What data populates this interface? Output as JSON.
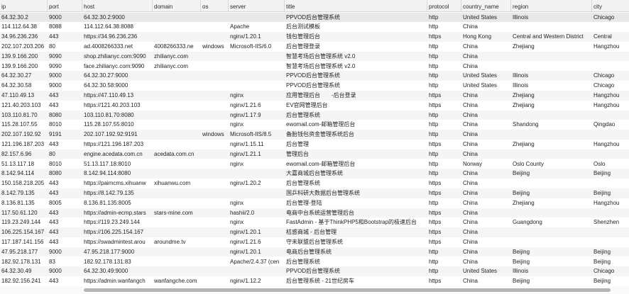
{
  "columns": [
    "ip",
    "port",
    "host",
    "domain",
    "os",
    "server",
    "title",
    "protocol",
    "country_name",
    "region",
    "city"
  ],
  "rows": [
    [
      "64.32.30.2",
      "9000",
      "64.32.30.2:9000",
      "",
      "",
      "",
      "PPVOD后台管理系统",
      "http",
      "United States",
      "Illinois",
      "Chicago"
    ],
    [
      "114.112.64.38",
      "8088",
      "114.112.64.38:8088",
      "",
      "",
      "Apache",
      "后台测试模板",
      "http",
      "China",
      "",
      ""
    ],
    [
      "34.96.236.236",
      "443",
      "https://34.96.236.236",
      "",
      "",
      "nginx/1.20.1",
      "钱包管理后台",
      "https",
      "Hong Kong",
      "Central and Western District",
      "Central"
    ],
    [
      "202.107.203.206",
      "80",
      "ad.4008266333.net",
      "4008266333.ne",
      "windows",
      "Microsoft-IIS/6.0",
      "后台管理登录",
      "http",
      "China",
      "Zhejiang",
      "Hangzhou"
    ],
    [
      "139.9.166.200",
      "9090",
      "shop.zhilianyc.com:9090",
      "zhilianyc.com",
      "",
      "",
      "智慧考场后台管理系统 v2.0",
      "http",
      "China",
      "",
      ""
    ],
    [
      "139.9.166.200",
      "9090",
      "face.zhilianyc.com:9090",
      "zhilianyc.com",
      "",
      "",
      "智慧考场后台管理系统 v2.0",
      "http",
      "China",
      "",
      ""
    ],
    [
      "64.32.30.27",
      "9000",
      "64.32.30.27:9000",
      "",
      "",
      "",
      "PPVOD后台管理系统",
      "http",
      "United States",
      "Illinois",
      "Chicago"
    ],
    [
      "64.32.30.58",
      "9000",
      "64.32.30.58:9000",
      "",
      "",
      "",
      "PPVOD后台管理系统",
      "http",
      "United States",
      "Illinois",
      "Chicago"
    ],
    [
      "47.110.49.13",
      "443",
      "https://47.110.49.13",
      "",
      "",
      "nginx",
      "应用管理后台　　-后台登录",
      "https",
      "China",
      "Zhejiang",
      "Hangzhou"
    ],
    [
      "121.40.203.103",
      "443",
      "https://121.40.203.103",
      "",
      "",
      "nginx/1.21.6",
      "EV官网管理后台",
      "https",
      "China",
      "Zhejiang",
      "Hangzhou"
    ],
    [
      "103.110.81.70",
      "8080",
      "103.110.81.70:8080",
      "",
      "",
      "nginx/1.17.9",
      "后台管理系统",
      "http",
      "China",
      "",
      ""
    ],
    [
      "115.28.107.55",
      "8010",
      "115.28.107.55:8010",
      "",
      "",
      "nginx",
      "ewomail.com-邮箱管理后台",
      "http",
      "China",
      "Shandong",
      "Qingdao"
    ],
    [
      "202.107.192.92",
      "9191",
      "202.107.192.92:9191",
      "",
      "windows",
      "Microsoft-IIS/8.5",
      "备胎钱包资金管理系统后台",
      "http",
      "China",
      "",
      ""
    ],
    [
      "121.196.187.203",
      "443",
      "https://121.196.187.203",
      "",
      "",
      "nginx/1.15.11",
      "后台管理",
      "https",
      "China",
      "Zhejiang",
      "Hangzhou"
    ],
    [
      "82.157.6.96",
      "80",
      "engine.acedata.com.cn",
      "acedata.com.cn",
      "",
      "nginx/1.21.1",
      "管理后台",
      "http",
      "China",
      "",
      ""
    ],
    [
      "51.13.117.18",
      "8010",
      "51.13.117.18:8010",
      "",
      "",
      "nginx",
      "ewomail.com-邮箱管理后台",
      "http",
      "Norway",
      "Oslo County",
      "Oslo"
    ],
    [
      "8.142.94.114",
      "8080",
      "8.142.94.114:8080",
      "",
      "",
      "",
      "大嘉商城后台管理系统",
      "http",
      "China",
      "Beijing",
      "Beijing"
    ],
    [
      "150.158.218.205",
      "443",
      "https://paimcms.xihuanw",
      "xihuanwu.com",
      "",
      "nginx/1.20.2",
      "后台管理系统",
      "https",
      "China",
      "",
      ""
    ],
    [
      "8.142.79.135",
      "443",
      "https://8.142.79.135",
      "",
      "",
      "",
      "国乒科研大数据后台管理系统",
      "https",
      "China",
      "Beijing",
      "Beijing"
    ],
    [
      "8.136.81.135",
      "8005",
      "8.136.81.135:8005",
      "",
      "",
      "nginx",
      "后台管理-登陆",
      "http",
      "China",
      "Zhejiang",
      "Hangzhou"
    ],
    [
      "117.50.61.120",
      "443",
      "https://admin-ecmp.stars",
      "stars-mine.com",
      "",
      "hashii/2.0",
      "电商中台系统运营管理后台",
      "https",
      "China",
      "",
      ""
    ],
    [
      "119.23.249.144",
      "443",
      "https://119.23.249.144",
      "",
      "",
      "nginx",
      "FastAdmin - 基于ThinkPHP5和Bootstrap的极速后台",
      "https",
      "China",
      "Guangdong",
      "Shenzhen"
    ],
    [
      "106.225.154.167",
      "443",
      "https://106.225.154.167",
      "",
      "",
      "nginx/1.20.1",
      "桔惑商城 - 后台管理",
      "https",
      "China",
      "",
      ""
    ],
    [
      "117.187.141.156",
      "443",
      "https://swadmintest.arou",
      "aroundme.tv",
      "",
      "nginx/1.21.6",
      "守未联盟后台管理系统",
      "https",
      "China",
      "",
      ""
    ],
    [
      "47.95.218.177",
      "9000",
      "47.95.218.177:9000",
      "",
      "",
      "nginx/1.20.1",
      "电商后台管理系统",
      "http",
      "China",
      "Beijing",
      "Beijing"
    ],
    [
      "182.92.178.131",
      "83",
      "182.92.178.131:83",
      "",
      "",
      "Apache/2.4.37 (cen",
      "后台管理系统",
      "http",
      "China",
      "Beijing",
      "Beijing"
    ],
    [
      "64.32.30.49",
      "9000",
      "64.32.30.49:9000",
      "",
      "",
      "",
      "PPVOD后台管理系统",
      "http",
      "United States",
      "Illinois",
      "Chicago"
    ],
    [
      "182.92.156.241",
      "443",
      "https://admin.wanfangch",
      "wanfangche.com",
      "",
      "nginx/1.12.2",
      "后台管理系统 - 21世纪房车",
      "https",
      "China",
      "Beijing",
      "Beijing"
    ]
  ]
}
